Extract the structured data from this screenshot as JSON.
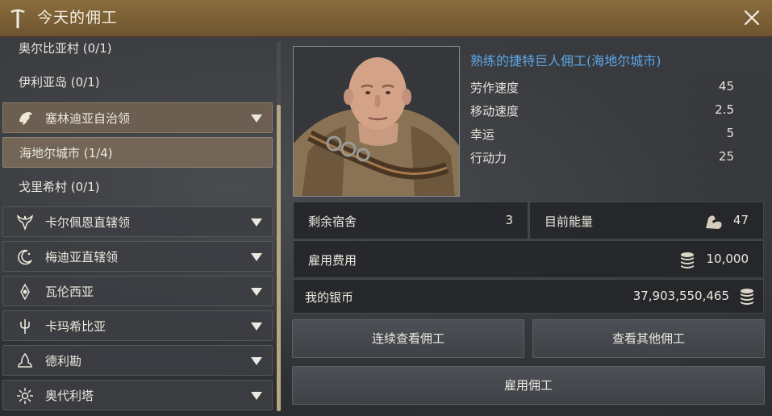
{
  "window": {
    "title": "今天的佣工",
    "title_icon": "worker-tool-icon",
    "close_icon": "close-icon"
  },
  "sidebar": {
    "items": [
      {
        "label": "奥尔比亚村 (0/1)",
        "type": "plain"
      },
      {
        "label": "伊利亚岛 (0/1)",
        "type": "plain"
      },
      {
        "label": "塞林迪亚自治领",
        "type": "group",
        "expanded": true,
        "icon": "eagle-crest-icon"
      },
      {
        "label": "海地尔城市 (1/4)",
        "type": "selected"
      },
      {
        "label": "戈里希村 (0/1)",
        "type": "plain"
      },
      {
        "label": "卡尔佩恩直辖领",
        "type": "group",
        "expanded": false,
        "icon": "winged-crest-icon"
      },
      {
        "label": "梅迪亚直辖领",
        "type": "group",
        "expanded": false,
        "icon": "crescent-moon-icon"
      },
      {
        "label": "瓦伦西亚",
        "type": "group",
        "expanded": false,
        "icon": "sun-emblem-icon"
      },
      {
        "label": "卡玛希比亚",
        "type": "group",
        "expanded": false,
        "icon": "trident-icon"
      },
      {
        "label": "德利勘",
        "type": "group",
        "expanded": false,
        "icon": "flame-emblem-icon"
      },
      {
        "label": "奥代利塔",
        "type": "group",
        "expanded": false,
        "icon": "sunburst-icon"
      }
    ]
  },
  "worker": {
    "name": "熟练的捷特巨人佣工(海地尔城市)",
    "stats": [
      {
        "label": "劳作速度",
        "value": "45"
      },
      {
        "label": "移动速度",
        "value": "2.5"
      },
      {
        "label": "幸运",
        "value": "5"
      },
      {
        "label": "行动力",
        "value": "25"
      }
    ]
  },
  "info": {
    "lodging_label": "剩余宿舍",
    "lodging_value": "3",
    "energy_label": "目前能量",
    "energy_value": "47",
    "cost_label": "雇用费用",
    "cost_value": "10,000",
    "silver_label": "我的银币",
    "silver_value": "37,903,550,465"
  },
  "buttons": {
    "continuous_view": "连续查看佣工",
    "view_others": "查看其他佣工",
    "hire": "雇用佣工"
  },
  "colors": {
    "title_bar": "#7a6035",
    "worker_name": "#5ea6e6",
    "selected_region": "#766858"
  }
}
